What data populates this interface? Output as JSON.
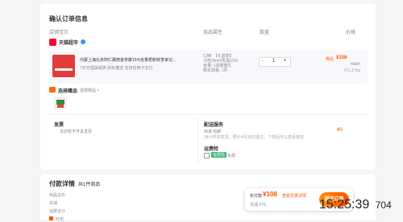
{
  "order": {
    "section_title": "确认订单信息",
    "columns": {
      "product": "店铺宝贝",
      "attrs": "商品属性",
      "quantity": "数量",
      "price": "价格"
    },
    "store": {
      "name": "天猫超市"
    },
    "item": {
      "title": "内蒙上海北京阿仁藁丽金奈聚15%含量栀新鲜李家记...",
      "service": "7天无理由退换  如实描述  支持信用卡支付",
      "attr_lines": [
        "口味: 【礼盒款】",
        "70包(5ml)/乳脂15%",
        "含量: 1盒装套礼",
        "购买规格: 1件"
      ],
      "qty": "1",
      "qty_minus": "−",
      "qty_plus": "+",
      "price_tag": "券后",
      "price": "¥108",
      "price_strike": "¥107",
      "price_unit": "约1.17kg"
    },
    "gift": {
      "label": "选择赠品",
      "link": "选择赠品 >"
    },
    "invoice": {
      "label": "发票",
      "value": "本店暂不开具发票"
    },
    "delivery": {
      "label": "配送服务",
      "method": "快递 包邮",
      "desc": "24小时内发货，预计4月28日送达，下单后可以查看物流",
      "fee": "¥0"
    },
    "insurance": {
      "label": "运费险",
      "badge": "运费险",
      "value": "免费"
    }
  },
  "payment": {
    "title": "付款详情",
    "count_label": "共1件商品",
    "rows": [
      {
        "label": "商品总价"
      },
      {
        "label": "共减"
      },
      {
        "label": "运费合计"
      },
      {
        "label": "红包"
      }
    ]
  },
  "checkout": {
    "total_label": "实付款",
    "total_value": "¥108",
    "coupon_hint": "查看优惠详情",
    "saved": "共减 ¥79",
    "submit_label": "提交订单"
  },
  "clock": {
    "time": "15:25:39",
    "suffix": "704"
  },
  "colors": {
    "accent": "#ff5000",
    "tmall": "#ff0036",
    "green": "#3eb575"
  }
}
